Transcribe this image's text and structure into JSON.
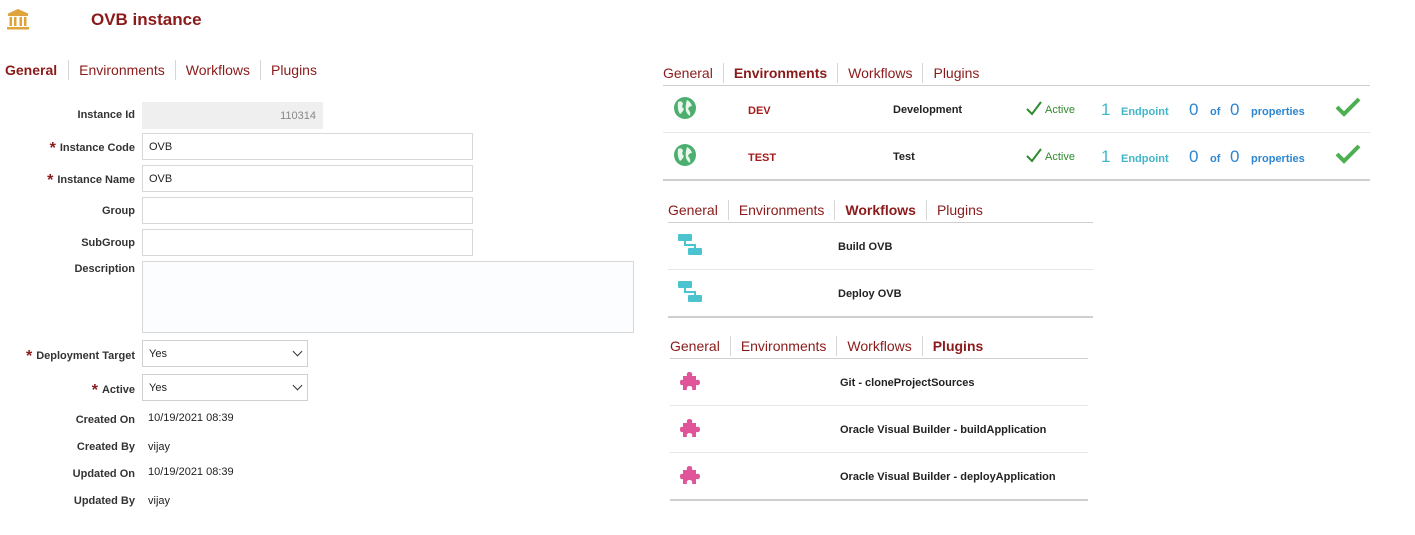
{
  "page": {
    "title": "OVB instance",
    "title_icon": "museum-icon"
  },
  "form_tabs": [
    "General",
    "Environments",
    "Workflows",
    "Plugins"
  ],
  "form_tabs_active": "General",
  "form": {
    "instance_id": {
      "label": "Instance Id",
      "value": "110314"
    },
    "instance_code": {
      "label": "Instance Code",
      "value": "OVB",
      "required": "*"
    },
    "instance_name": {
      "label": "Instance Name",
      "value": "OVB",
      "required": "*"
    },
    "group": {
      "label": "Group",
      "value": ""
    },
    "subgroup": {
      "label": "SubGroup",
      "value": ""
    },
    "description": {
      "label": "Description",
      "value": ""
    },
    "deployment_target": {
      "label": "Deployment Target",
      "value": "Yes",
      "required": "*"
    },
    "active": {
      "label": "Active",
      "value": "Yes",
      "required": "*"
    },
    "created_on": {
      "label": "Created On",
      "value": "10/19/2021 08:39"
    },
    "created_by": {
      "label": "Created By",
      "value": "vijay"
    },
    "updated_on": {
      "label": "Updated On",
      "value": "10/19/2021 08:39"
    },
    "updated_by": {
      "label": "Updated By",
      "value": "vijay"
    }
  },
  "env_panel": {
    "tabs": [
      "General",
      "Environments",
      "Workflows",
      "Plugins"
    ],
    "active_tab": "Environments",
    "rows": [
      {
        "code": "DEV",
        "name": "Development",
        "status": "Active",
        "endpoints": "1",
        "endpoint_label": "Endpoint",
        "props_set": "0",
        "of": "of",
        "props_total": "0",
        "props_label": "properties"
      },
      {
        "code": "TEST",
        "name": "Test",
        "status": "Active",
        "endpoints": "1",
        "endpoint_label": "Endpoint",
        "props_set": "0",
        "of": "of",
        "props_total": "0",
        "props_label": "properties"
      }
    ]
  },
  "workflows_panel": {
    "tabs": [
      "General",
      "Environments",
      "Workflows",
      "Plugins"
    ],
    "active_tab": "Workflows",
    "items": [
      "Build OVB",
      "Deploy OVB"
    ]
  },
  "plugins_panel": {
    "tabs": [
      "General",
      "Environments",
      "Workflows",
      "Plugins"
    ],
    "active_tab": "Plugins",
    "items": [
      "Git - cloneProjectSources",
      "Oracle Visual Builder - buildApplication",
      "Oracle Visual Builder - deployApplication"
    ]
  },
  "colors": {
    "accent": "#8b1a1a",
    "link": "#2e86d0",
    "success": "#4caf50",
    "workflow": "#4cc4cf",
    "plugin": "#e0559a"
  }
}
